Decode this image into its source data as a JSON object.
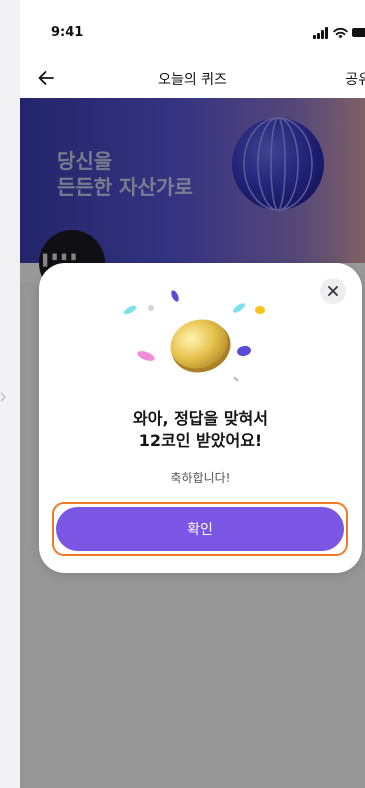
{
  "status_bar": {
    "time": "9:41"
  },
  "nav": {
    "title": "오늘의 퀴즈",
    "share_label": "공유"
  },
  "banner": {
    "title_line1": "당신을",
    "title_line2": "든든한 자산가로"
  },
  "popup": {
    "title_line1": "와아, 정답을 맞혀서",
    "title_line2": "12코인 받았어요!",
    "subtitle": "축하합니다!",
    "confirm_label": "확인"
  },
  "colors": {
    "accent": "#7b55e4",
    "highlight": "#f07a28",
    "coin": "#e3c14c",
    "banner": "#4a47c9"
  }
}
